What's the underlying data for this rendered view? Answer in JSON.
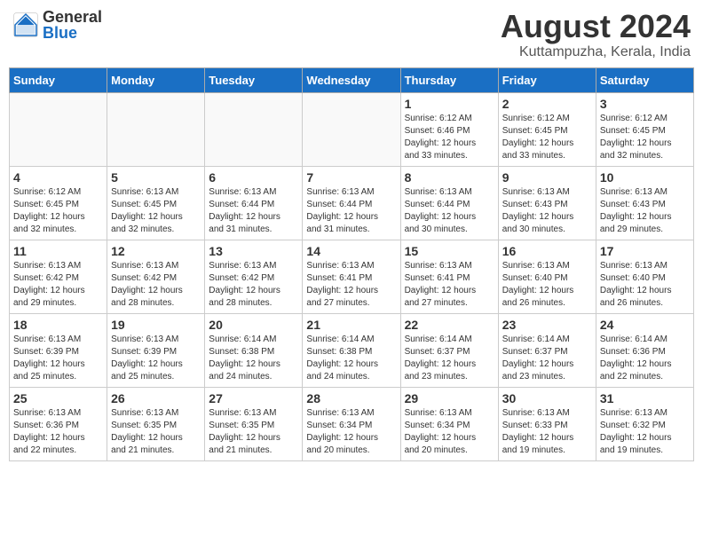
{
  "header": {
    "logo_general": "General",
    "logo_blue": "Blue",
    "title": "August 2024",
    "subtitle": "Kuttampuzha, Kerala, India"
  },
  "days_of_week": [
    "Sunday",
    "Monday",
    "Tuesday",
    "Wednesday",
    "Thursday",
    "Friday",
    "Saturday"
  ],
  "weeks": [
    [
      {
        "day": "",
        "info": ""
      },
      {
        "day": "",
        "info": ""
      },
      {
        "day": "",
        "info": ""
      },
      {
        "day": "",
        "info": ""
      },
      {
        "day": "1",
        "info": "Sunrise: 6:12 AM\nSunset: 6:46 PM\nDaylight: 12 hours\nand 33 minutes."
      },
      {
        "day": "2",
        "info": "Sunrise: 6:12 AM\nSunset: 6:45 PM\nDaylight: 12 hours\nand 33 minutes."
      },
      {
        "day": "3",
        "info": "Sunrise: 6:12 AM\nSunset: 6:45 PM\nDaylight: 12 hours\nand 32 minutes."
      }
    ],
    [
      {
        "day": "4",
        "info": "Sunrise: 6:12 AM\nSunset: 6:45 PM\nDaylight: 12 hours\nand 32 minutes."
      },
      {
        "day": "5",
        "info": "Sunrise: 6:13 AM\nSunset: 6:45 PM\nDaylight: 12 hours\nand 32 minutes."
      },
      {
        "day": "6",
        "info": "Sunrise: 6:13 AM\nSunset: 6:44 PM\nDaylight: 12 hours\nand 31 minutes."
      },
      {
        "day": "7",
        "info": "Sunrise: 6:13 AM\nSunset: 6:44 PM\nDaylight: 12 hours\nand 31 minutes."
      },
      {
        "day": "8",
        "info": "Sunrise: 6:13 AM\nSunset: 6:44 PM\nDaylight: 12 hours\nand 30 minutes."
      },
      {
        "day": "9",
        "info": "Sunrise: 6:13 AM\nSunset: 6:43 PM\nDaylight: 12 hours\nand 30 minutes."
      },
      {
        "day": "10",
        "info": "Sunrise: 6:13 AM\nSunset: 6:43 PM\nDaylight: 12 hours\nand 29 minutes."
      }
    ],
    [
      {
        "day": "11",
        "info": "Sunrise: 6:13 AM\nSunset: 6:42 PM\nDaylight: 12 hours\nand 29 minutes."
      },
      {
        "day": "12",
        "info": "Sunrise: 6:13 AM\nSunset: 6:42 PM\nDaylight: 12 hours\nand 28 minutes."
      },
      {
        "day": "13",
        "info": "Sunrise: 6:13 AM\nSunset: 6:42 PM\nDaylight: 12 hours\nand 28 minutes."
      },
      {
        "day": "14",
        "info": "Sunrise: 6:13 AM\nSunset: 6:41 PM\nDaylight: 12 hours\nand 27 minutes."
      },
      {
        "day": "15",
        "info": "Sunrise: 6:13 AM\nSunset: 6:41 PM\nDaylight: 12 hours\nand 27 minutes."
      },
      {
        "day": "16",
        "info": "Sunrise: 6:13 AM\nSunset: 6:40 PM\nDaylight: 12 hours\nand 26 minutes."
      },
      {
        "day": "17",
        "info": "Sunrise: 6:13 AM\nSunset: 6:40 PM\nDaylight: 12 hours\nand 26 minutes."
      }
    ],
    [
      {
        "day": "18",
        "info": "Sunrise: 6:13 AM\nSunset: 6:39 PM\nDaylight: 12 hours\nand 25 minutes."
      },
      {
        "day": "19",
        "info": "Sunrise: 6:13 AM\nSunset: 6:39 PM\nDaylight: 12 hours\nand 25 minutes."
      },
      {
        "day": "20",
        "info": "Sunrise: 6:14 AM\nSunset: 6:38 PM\nDaylight: 12 hours\nand 24 minutes."
      },
      {
        "day": "21",
        "info": "Sunrise: 6:14 AM\nSunset: 6:38 PM\nDaylight: 12 hours\nand 24 minutes."
      },
      {
        "day": "22",
        "info": "Sunrise: 6:14 AM\nSunset: 6:37 PM\nDaylight: 12 hours\nand 23 minutes."
      },
      {
        "day": "23",
        "info": "Sunrise: 6:14 AM\nSunset: 6:37 PM\nDaylight: 12 hours\nand 23 minutes."
      },
      {
        "day": "24",
        "info": "Sunrise: 6:14 AM\nSunset: 6:36 PM\nDaylight: 12 hours\nand 22 minutes."
      }
    ],
    [
      {
        "day": "25",
        "info": "Sunrise: 6:13 AM\nSunset: 6:36 PM\nDaylight: 12 hours\nand 22 minutes."
      },
      {
        "day": "26",
        "info": "Sunrise: 6:13 AM\nSunset: 6:35 PM\nDaylight: 12 hours\nand 21 minutes."
      },
      {
        "day": "27",
        "info": "Sunrise: 6:13 AM\nSunset: 6:35 PM\nDaylight: 12 hours\nand 21 minutes."
      },
      {
        "day": "28",
        "info": "Sunrise: 6:13 AM\nSunset: 6:34 PM\nDaylight: 12 hours\nand 20 minutes."
      },
      {
        "day": "29",
        "info": "Sunrise: 6:13 AM\nSunset: 6:34 PM\nDaylight: 12 hours\nand 20 minutes."
      },
      {
        "day": "30",
        "info": "Sunrise: 6:13 AM\nSunset: 6:33 PM\nDaylight: 12 hours\nand 19 minutes."
      },
      {
        "day": "31",
        "info": "Sunrise: 6:13 AM\nSunset: 6:32 PM\nDaylight: 12 hours\nand 19 minutes."
      }
    ]
  ]
}
